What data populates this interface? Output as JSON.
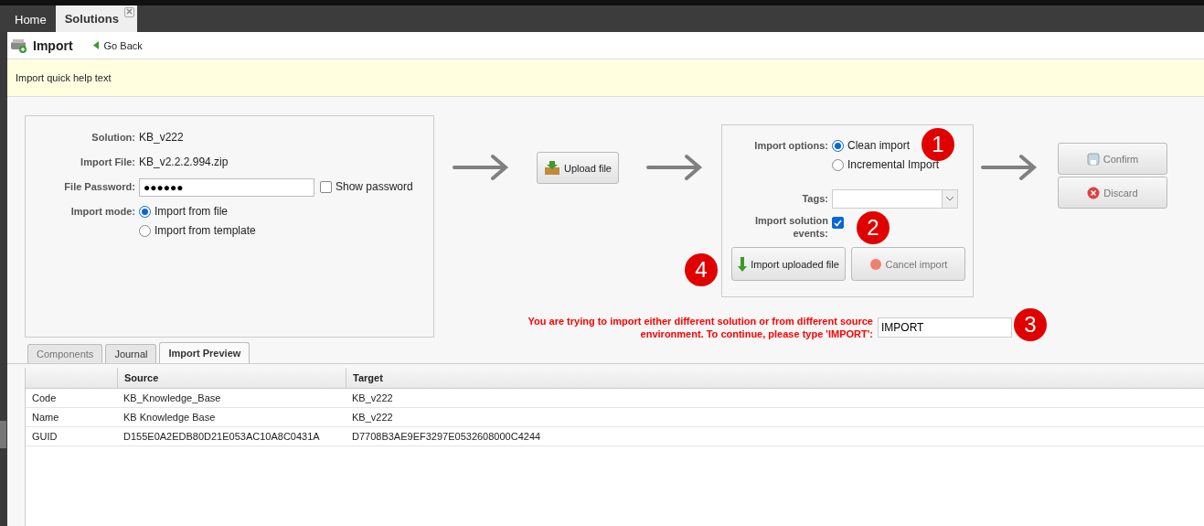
{
  "app_tabs": [
    {
      "label": "Home",
      "selected": false,
      "closable": false
    },
    {
      "label": "Solutions",
      "selected": true,
      "closable": true
    }
  ],
  "page": {
    "title": "Import",
    "back": "Go Back"
  },
  "help_text": "Import quick help text",
  "solution_form": {
    "solution_label": "Solution:",
    "solution": "KB_v222",
    "file_label": "Import File:",
    "file": "KB_v2.2.2.994.zip",
    "password_label": "File Password:",
    "password": "●●●●●●",
    "show_password": {
      "label": "Show password",
      "checked": false
    },
    "mode_label": "Import mode:",
    "modes": [
      {
        "label": "Import from file",
        "selected": true
      },
      {
        "label": "Import from template",
        "selected": false
      }
    ]
  },
  "upload_button": "Upload file",
  "import_options": {
    "label": "Import options:",
    "options": [
      {
        "label": "Clean import",
        "selected": true
      },
      {
        "label": "Incremental Import",
        "selected": false
      }
    ],
    "tags_label": "Tags:",
    "events_label": "Import solution events:",
    "events_checked": true,
    "import_button": {
      "label": "Import uploaded file",
      "disabled": false
    },
    "cancel_button": {
      "label": "Cancel import",
      "disabled": true
    }
  },
  "warning": {
    "text": "You are trying to import either different solution or from different source environment. To continue, please type 'IMPORT':",
    "value": "IMPORT"
  },
  "actions": [
    {
      "kind": "confirm",
      "label": "Confirm",
      "disabled": true
    },
    {
      "kind": "discard",
      "label": "Discard",
      "disabled": true
    }
  ],
  "badges": [
    "1",
    "2",
    "3",
    "4"
  ],
  "bottom_tabs": [
    {
      "label": "Components",
      "selected": false,
      "disabled": true
    },
    {
      "label": "Journal",
      "selected": false,
      "disabled": false
    },
    {
      "label": "Import Preview",
      "selected": true,
      "disabled": false
    }
  ],
  "table": {
    "columns": [
      "Source",
      "Target"
    ],
    "rows": [
      {
        "label": "Code",
        "source": "KB_Knowledge_Base",
        "target": "KB_v222"
      },
      {
        "label": "Name",
        "source": "KB Knowledge Base",
        "target": "KB_v222"
      },
      {
        "label": "GUID",
        "source": "D155E0A2EDB80D21E053AC10A8C0431A",
        "target": "D7708B3AE9EF3297E0532608000C4244"
      }
    ]
  }
}
